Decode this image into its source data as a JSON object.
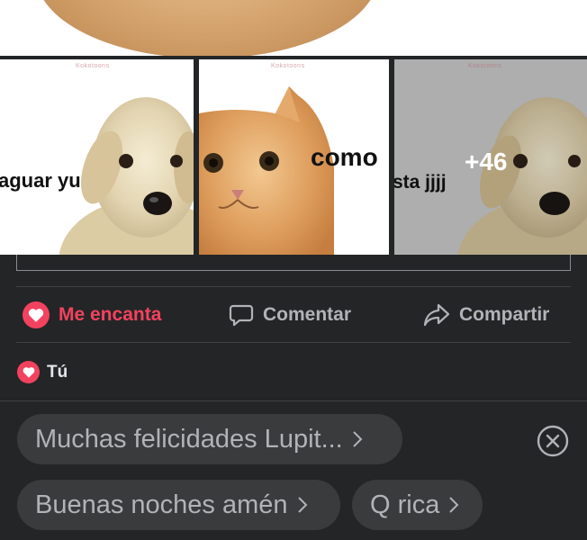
{
  "watermark": "Kokotoons",
  "images": [
    {
      "caption": "aguar yu",
      "subject": "puppy"
    },
    {
      "caption": "como",
      "subject": "cat"
    },
    {
      "caption": "sta jjjj",
      "subject": "puppy"
    }
  ],
  "more_photos": "+46",
  "actions": {
    "like_label": "Me encanta",
    "comment_label": "Comentar",
    "share_label": "Compartir"
  },
  "reactions": {
    "names": "Tú"
  },
  "quick_replies": [
    "Muchas felicidades Lupit...",
    "Buenas noches amén",
    "Q rica"
  ],
  "colors": {
    "background": "#242526",
    "chip": "#3a3b3c",
    "accent_love": "#f3425f",
    "text_secondary": "#b0b3b8"
  },
  "icons": {
    "like": "heart-icon",
    "comment": "comment-bubble-icon",
    "share": "share-arrow-icon",
    "reaction": "heart-icon",
    "chip": "chevron-right-icon",
    "dismiss": "close-circle-icon"
  }
}
